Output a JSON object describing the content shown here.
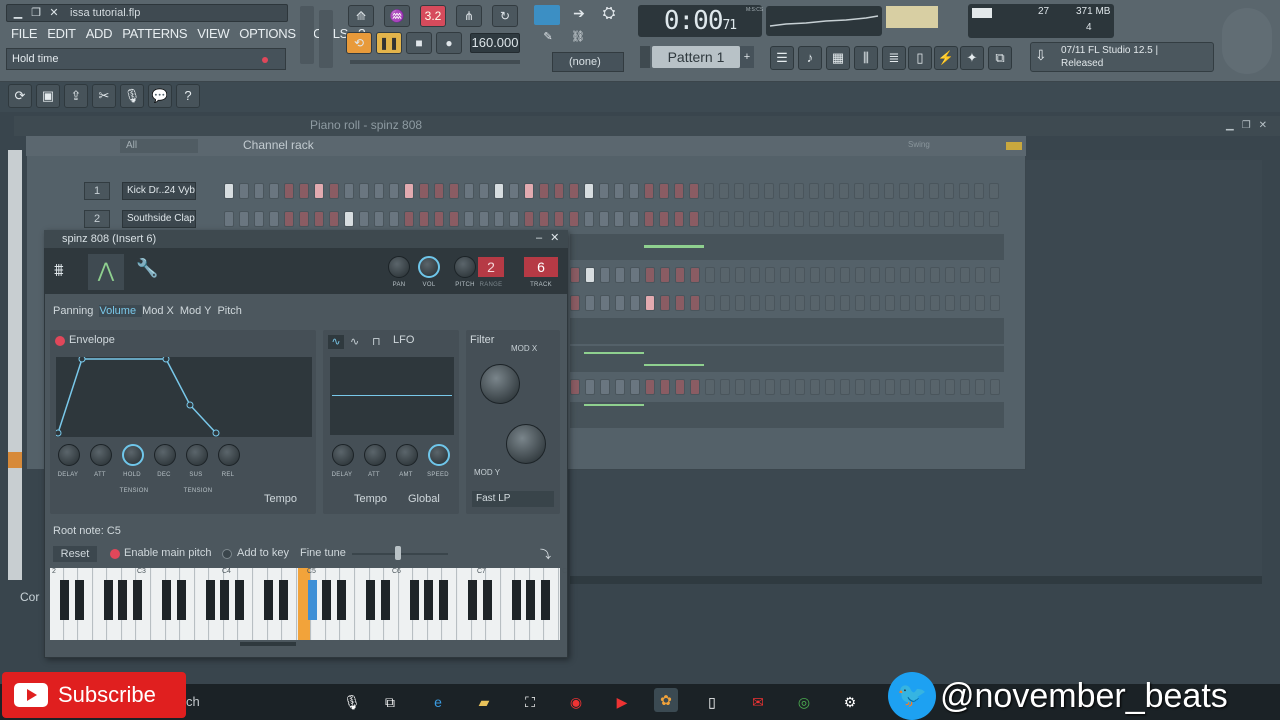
{
  "window": {
    "project_title": "issa tutorial.flp"
  },
  "menu": [
    "FILE",
    "EDIT",
    "ADD",
    "PATTERNS",
    "VIEW",
    "OPTIONS",
    "TOOLS",
    "?"
  ],
  "hint_bar": {
    "text": "Hold time"
  },
  "transport": {
    "snap_value": "3.2",
    "tempo": "160.000",
    "time_main": "0:00",
    "time_sub": "71",
    "time_label": "M:S:CS",
    "pattern": "Pattern 1",
    "none_select": "(none)"
  },
  "cpu": {
    "value": "27",
    "memory": "371 MB",
    "poly": "4"
  },
  "news": {
    "line1": "07/11  FL Studio 12.5 |",
    "line2": "Released"
  },
  "piano_roll": {
    "title": "Piano roll - spinz 808"
  },
  "channel_rack": {
    "title": "Channel rack",
    "filter": "All",
    "swing_label": "Swing",
    "channels": [
      {
        "num": "1",
        "name": "Kick Dr..24 Vybe"
      },
      {
        "num": "2",
        "name": "Southside Clap"
      }
    ]
  },
  "plugin": {
    "title": "spinz 808 (Insert 6)",
    "knob_labels": {
      "pan": "PAN",
      "vol": "VOL",
      "pitch": "PITCH",
      "range": "RANGE",
      "track": "TRACK"
    },
    "range_value": "2",
    "track_value": "6",
    "tabs": [
      "Panning",
      "Volume",
      "Mod X",
      "Mod Y",
      "Pitch"
    ],
    "active_tab": "Volume",
    "envelope_label": "Envelope",
    "env_knobs": [
      "DELAY",
      "ATT",
      "HOLD",
      "DEC",
      "SUS",
      "REL"
    ],
    "tension": "TENSION",
    "tempo_label": "Tempo",
    "lfo_label": "LFO",
    "lfo_knobs": [
      "DELAY",
      "ATT",
      "AMT",
      "SPEED"
    ],
    "lfo_tempo": "Tempo",
    "global_label": "Global",
    "filter_label": "Filter",
    "modx_label": "MOD X",
    "mody_label": "MOD Y",
    "filter_type": "Fast LP",
    "root_note": "Root note: C5",
    "reset": "Reset",
    "enable_pitch": "Enable main pitch",
    "add_to_key": "Add to key",
    "fine_tune": "Fine tune",
    "octaves": [
      "2",
      "C3",
      "C4",
      "C5",
      "C6",
      "C7",
      "C"
    ]
  },
  "overlay": {
    "subscribe": "Subscribe",
    "handle": "@november_beats",
    "search_partial": "ch",
    "cor_label": "Cor"
  },
  "colors": {
    "accent": "#79c8ea",
    "red": "#e0475a",
    "range_bg": "#b63a45"
  }
}
